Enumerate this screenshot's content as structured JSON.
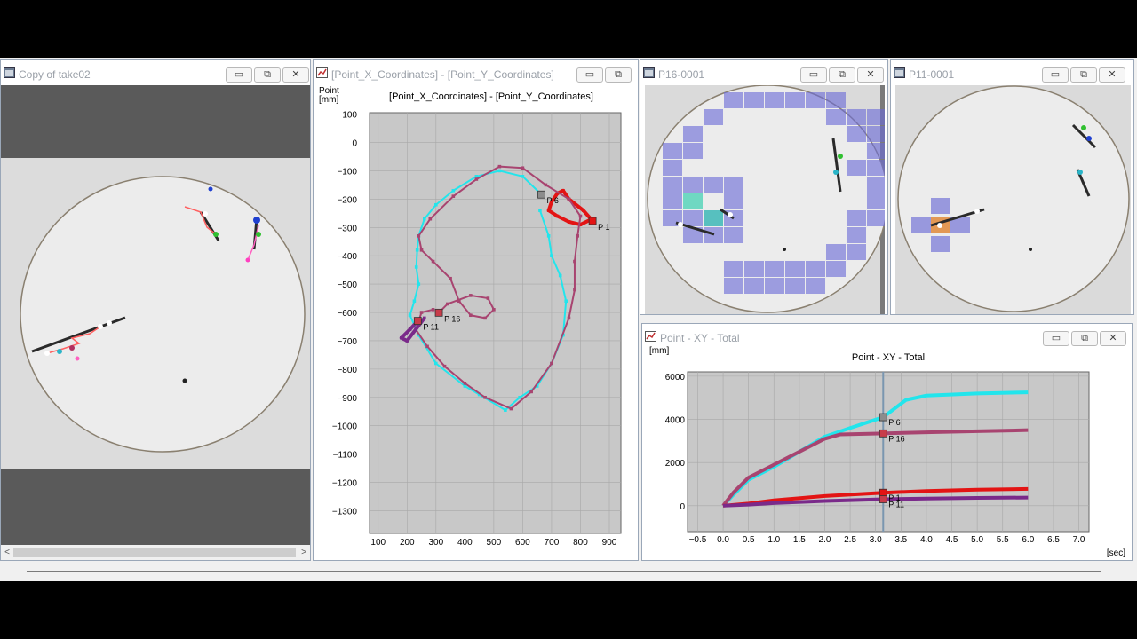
{
  "windows": {
    "video1": {
      "title": "Copy of take02"
    },
    "xyplot": {
      "title": "[Point_X_Coordinates] - [Point_Y_Coordinates]"
    },
    "p16": {
      "title": "P16-0001"
    },
    "p11": {
      "title": "P11-0001"
    },
    "total": {
      "title": "Point - XY - Total"
    }
  },
  "window_buttons": {
    "minimize": "▭",
    "restore": "⧉",
    "close": "✕"
  },
  "scroll_arrows": {
    "left": "<",
    "right": ">"
  },
  "xy_chart": {
    "title": "[Point_X_Coordinates] - [Point_Y_Coordinates]",
    "ylabel_line1": "Point",
    "ylabel_line2": "[mm]",
    "xticks": [
      "100",
      "200",
      "300",
      "400",
      "500",
      "600",
      "700",
      "800",
      "900"
    ],
    "yticks": [
      "100",
      "0",
      "−100",
      "−200",
      "−300",
      "−400",
      "−500",
      "−600",
      "−700",
      "−800",
      "−900",
      "−1000",
      "−1100",
      "−1200",
      "−1300"
    ],
    "markers": [
      {
        "label": "P 6",
        "x": 665,
        "y": -184,
        "color": "#8c8c8c"
      },
      {
        "label": "P 1",
        "x": 842,
        "y": -277,
        "color": "#e31414"
      },
      {
        "label": "P 16",
        "x": 310,
        "y": -601,
        "color": "#c83c4a"
      },
      {
        "label": "P 11",
        "x": 237,
        "y": -630,
        "color": "#c83c4a"
      }
    ]
  },
  "total_chart": {
    "title": "Point - XY - Total",
    "ylabel": "[mm]",
    "xlabel": "[sec]",
    "xticks": [
      "−0.5",
      "0.0",
      "0.5",
      "1.0",
      "1.5",
      "2.0",
      "2.5",
      "3.0",
      "3.5",
      "4.0",
      "4.5",
      "5.0",
      "5.5",
      "6.0",
      "6.5",
      "7.0"
    ],
    "yticks": [
      "6000",
      "4000",
      "2000",
      "0"
    ],
    "markers": [
      {
        "label": "P 6",
        "color": "#8c8c8c"
      },
      {
        "label": "P 16",
        "color": "#c83c4a"
      },
      {
        "label": "P 1",
        "color": "#e31414"
      },
      {
        "label": "P 11",
        "color": "#c83c4a"
      }
    ]
  },
  "chart_data": [
    {
      "type": "scatter",
      "title": "[Point_X_Coordinates] - [Point_Y_Coordinates]",
      "ylabel": "Point [mm]",
      "xlim": [
        70,
        940
      ],
      "ylim": [
        -1380,
        105
      ],
      "grid": true,
      "series": [
        {
          "name": "P 6",
          "color": "#22e5ec",
          "points": [
            [
              665,
              -184
            ],
            [
              600,
              -120
            ],
            [
              520,
              -100
            ],
            [
              440,
              -120
            ],
            [
              360,
              -170
            ],
            [
              300,
              -220
            ],
            [
              260,
              -270
            ],
            [
              240,
              -330
            ],
            [
              235,
              -380
            ],
            [
              232,
              -440
            ],
            [
              240,
              -500
            ],
            [
              225,
              -560
            ],
            [
              210,
              -610
            ],
            [
              240,
              -680
            ],
            [
              300,
              -780
            ],
            [
              400,
              -860
            ],
            [
              450,
              -890
            ],
            [
              540,
              -945
            ],
            [
              590,
              -900
            ],
            [
              650,
              -860
            ],
            [
              700,
              -780
            ],
            [
              740,
              -680
            ],
            [
              750,
              -560
            ],
            [
              730,
              -470
            ],
            [
              700,
              -400
            ],
            [
              690,
              -330
            ],
            [
              660,
              -240
            ]
          ]
        },
        {
          "name": "P 1",
          "color": "#e31414",
          "points": [
            [
              842,
              -277
            ],
            [
              810,
              -240
            ],
            [
              760,
              -200
            ],
            [
              740,
              -170
            ],
            [
              720,
              -180
            ],
            [
              700,
              -210
            ],
            [
              690,
              -240
            ],
            [
              720,
              -260
            ],
            [
              760,
              -280
            ],
            [
              800,
              -290
            ],
            [
              840,
              -270
            ]
          ]
        },
        {
          "name": "P 16",
          "color": "#a84470",
          "points": [
            [
              310,
              -601
            ],
            [
              340,
              -570
            ],
            [
              420,
              -540
            ],
            [
              480,
              -550
            ],
            [
              500,
              -590
            ],
            [
              470,
              -620
            ],
            [
              420,
              -610
            ],
            [
              380,
              -560
            ],
            [
              350,
              -480
            ],
            [
              290,
              -420
            ],
            [
              250,
              -380
            ],
            [
              240,
              -330
            ],
            [
              280,
              -270
            ],
            [
              360,
              -190
            ],
            [
              440,
              -130
            ],
            [
              520,
              -85
            ],
            [
              600,
              -90
            ],
            [
              680,
              -150
            ],
            [
              760,
              -200
            ],
            [
              800,
              -260
            ],
            [
              790,
              -330
            ],
            [
              780,
              -420
            ],
            [
              780,
              -520
            ],
            [
              760,
              -620
            ],
            [
              700,
              -780
            ],
            [
              630,
              -880
            ],
            [
              560,
              -940
            ],
            [
              470,
              -900
            ],
            [
              400,
              -850
            ],
            [
              330,
              -790
            ],
            [
              270,
              -720
            ],
            [
              230,
              -660
            ],
            [
              250,
              -600
            ],
            [
              290,
              -590
            ]
          ]
        },
        {
          "name": "P 11",
          "color": "#7a2a8a",
          "points": [
            [
              237,
              -630
            ],
            [
              210,
              -660
            ],
            [
              180,
              -690
            ],
            [
              200,
              -700
            ],
            [
              230,
              -660
            ],
            [
              260,
              -620
            ]
          ]
        }
      ]
    },
    {
      "type": "line",
      "title": "Point - XY - Total",
      "ylabel": "[mm]",
      "xlabel": "[sec]",
      "xlim": [
        -0.7,
        7.2
      ],
      "ylim": [
        -1200,
        6200
      ],
      "grid": true,
      "cursor_x": 3.15,
      "series": [
        {
          "name": "P 6",
          "color": "#22e5ec",
          "points": [
            [
              0,
              0
            ],
            [
              0.2,
              500
            ],
            [
              0.5,
              1200
            ],
            [
              1.0,
              1800
            ],
            [
              1.5,
              2500
            ],
            [
              2.0,
              3200
            ],
            [
              2.5,
              3600
            ],
            [
              3.15,
              4100
            ],
            [
              3.6,
              4900
            ],
            [
              4.0,
              5100
            ],
            [
              5.0,
              5200
            ],
            [
              6.0,
              5250
            ]
          ]
        },
        {
          "name": "P 16",
          "color": "#a84470",
          "points": [
            [
              0,
              0
            ],
            [
              0.2,
              600
            ],
            [
              0.5,
              1300
            ],
            [
              1.0,
              1900
            ],
            [
              1.5,
              2500
            ],
            [
              2.0,
              3100
            ],
            [
              2.3,
              3300
            ],
            [
              3.15,
              3350
            ],
            [
              4.0,
              3400
            ],
            [
              5.0,
              3450
            ],
            [
              6.0,
              3500
            ]
          ]
        },
        {
          "name": "P 1",
          "color": "#e31414",
          "points": [
            [
              0,
              0
            ],
            [
              0.5,
              100
            ],
            [
              1.0,
              250
            ],
            [
              2.0,
              450
            ],
            [
              3.15,
              600
            ],
            [
              4.0,
              680
            ],
            [
              5.0,
              740
            ],
            [
              6.0,
              780
            ]
          ]
        },
        {
          "name": "P 11",
          "color": "#7a2a8a",
          "points": [
            [
              0,
              0
            ],
            [
              0.5,
              50
            ],
            [
              1.0,
              120
            ],
            [
              2.0,
              220
            ],
            [
              3.15,
              300
            ],
            [
              4.0,
              330
            ],
            [
              5.0,
              360
            ],
            [
              6.0,
              380
            ]
          ]
        }
      ]
    }
  ]
}
